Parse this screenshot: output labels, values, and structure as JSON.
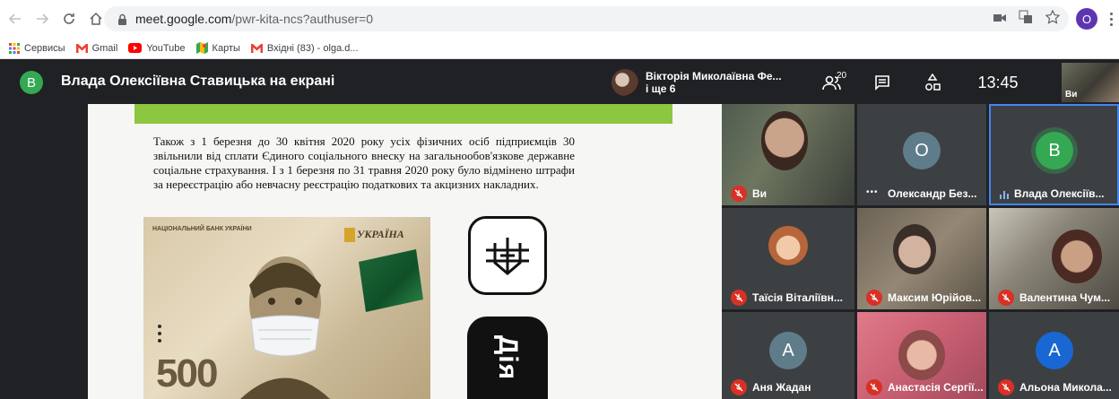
{
  "browser": {
    "url_host": "meet.google.com",
    "url_path": "/pwr-kita-ncs?authuser=0",
    "profile_initial": "O",
    "bookmarks": [
      {
        "label": "Сервисы",
        "icon": "apps-grid-icon"
      },
      {
        "label": "Gmail",
        "icon": "gmail-icon"
      },
      {
        "label": "YouTube",
        "icon": "youtube-icon"
      },
      {
        "label": "Карты",
        "icon": "maps-icon"
      },
      {
        "label": "Вхідні (83) - olga.d...",
        "icon": "gmail-icon"
      }
    ]
  },
  "meet": {
    "presenter_initial": "В",
    "presentation_title": "Влада Олексіївна Ставицька на екрані",
    "speaker_name": "Вікторія Миколаївна Фе...",
    "speaker_more": "і ще 6",
    "people_count": "20",
    "time": "13:45",
    "self_label": "Ви"
  },
  "slide": {
    "text": "Також з 1 березня до 30 квітня 2020 року усіх фізичних осіб підприємців 30 звільнили від сплати Єдиного соціального внеску на загальнообов'язкове державне соціальне страхування. І з 1 березня по 31 травня 2020 року було відмінено штрафи за нереєстрацію або невчасну реєстрацію податкових та акцизних накладних.",
    "banknote_bank": "НАЦІОНАЛЬНИЙ БАНК УКРАЇНИ",
    "banknote_country": "УКРАЇНА",
    "banknote_value": "500",
    "app_label": "Дія"
  },
  "participants": [
    {
      "name": "Ви",
      "type": "video",
      "muted": true
    },
    {
      "name": "Олександр Без...",
      "initial": "О",
      "avatar_color": "#5f7c8a",
      "muted": false,
      "status": "dots"
    },
    {
      "name": "Влада Олексіїв...",
      "initial": "В",
      "avatar_color": "#34a853",
      "muted": false,
      "status": "speaking"
    },
    {
      "name": "Таїсія Віталіївн...",
      "type": "photo",
      "muted": true
    },
    {
      "name": "Максим Юрійов...",
      "type": "video",
      "muted": true
    },
    {
      "name": "Валентина Чум...",
      "type": "video",
      "muted": true
    },
    {
      "name": "Аня Жадан",
      "initial": "А",
      "avatar_color": "#5f7c8a",
      "muted": true
    },
    {
      "name": "Анастасія Сергії...",
      "type": "video",
      "muted": true
    },
    {
      "name": "Альона Микола...",
      "initial": "А",
      "avatar_color": "#1967d2",
      "muted": true
    }
  ]
}
